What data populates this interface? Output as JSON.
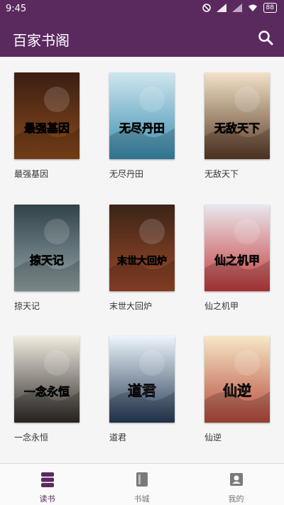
{
  "status": {
    "time": "9:45",
    "battery": "88"
  },
  "appbar": {
    "title": "百家书阁",
    "search_icon": "search-icon"
  },
  "books": [
    {
      "title": "最强基因",
      "cover_text": "最强基因",
      "colors": [
        "#3a1e12",
        "#8b4a1d"
      ]
    },
    {
      "title": "无尽丹田",
      "cover_text": "无尽丹田",
      "colors": [
        "#cfe6ef",
        "#3a8db0"
      ]
    },
    {
      "title": "无敌天下",
      "cover_text": "无敌天下",
      "colors": [
        "#f2e2c9",
        "#5b3c26"
      ]
    },
    {
      "title": "掠天记",
      "cover_text": "掠天记",
      "colors": [
        "#314249",
        "#95a5a8"
      ]
    },
    {
      "title": "末世大回炉",
      "cover_text": "末世大回炉",
      "colors": [
        "#3a2416",
        "#9d4a2b"
      ]
    },
    {
      "title": "仙之机甲",
      "cover_text": "仙之机甲",
      "colors": [
        "#e8e8ee",
        "#c53b3b"
      ]
    },
    {
      "title": "一念永恒",
      "cover_text": "一念永恒",
      "colors": [
        "#f1ece1",
        "#2e2a26"
      ]
    },
    {
      "title": "道君",
      "cover_text": "道君",
      "colors": [
        "#eef5fb",
        "#263b57"
      ]
    },
    {
      "title": "仙逆",
      "cover_text": "仙逆",
      "colors": [
        "#f6e8c7",
        "#b74a3b"
      ]
    }
  ],
  "nav": {
    "tabs": [
      {
        "label": "读书",
        "icon": "stack-icon",
        "active": true
      },
      {
        "label": "书城",
        "icon": "book-icon",
        "active": false
      },
      {
        "label": "我的",
        "icon": "profile-icon",
        "active": false
      }
    ]
  },
  "colors": {
    "primary": "#5a2a5f"
  }
}
